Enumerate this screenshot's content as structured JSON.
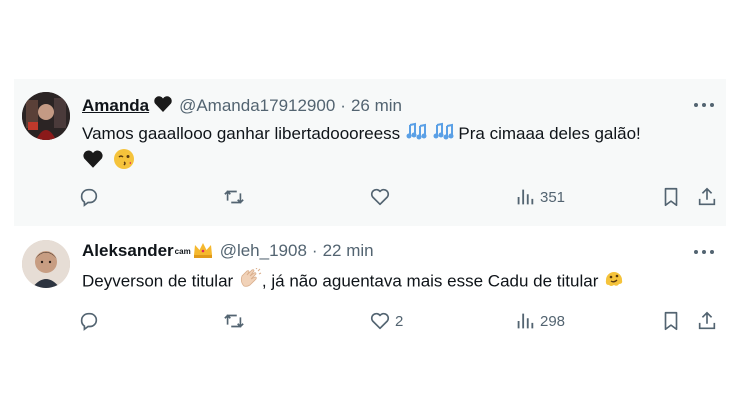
{
  "tweets": [
    {
      "name": "Amanda",
      "name_suffix": "",
      "handle": "@Amanda17912900",
      "separator": "·",
      "time": "26 min",
      "text_part1": "Vamos gaaallooo ganhar libertadoooreess",
      "text_part2": "Pra cimaaa deles galão!",
      "emojis": [
        "black-heart",
        "musical-notes",
        "musical-notes",
        "black-heart",
        "winking-kiss"
      ],
      "stats": {
        "replies": "",
        "retweets": "",
        "likes": "",
        "views": "351"
      }
    },
    {
      "name": "Aleksander",
      "name_suffix": "cam",
      "handle": "@leh_1908",
      "separator": "·",
      "time": "22 min",
      "text_part1": "Deyverson de titular",
      "text_part2": ", já não aguentava mais esse Cadu de titular",
      "emojis": [
        "crown",
        "clapping-hands",
        "melting-face"
      ],
      "stats": {
        "replies": "",
        "retweets": "",
        "likes": "2",
        "views": "298"
      }
    }
  ],
  "colors": {
    "text": "#0f1419",
    "muted": "#536471",
    "hover_bg": "#f7f9f9"
  }
}
